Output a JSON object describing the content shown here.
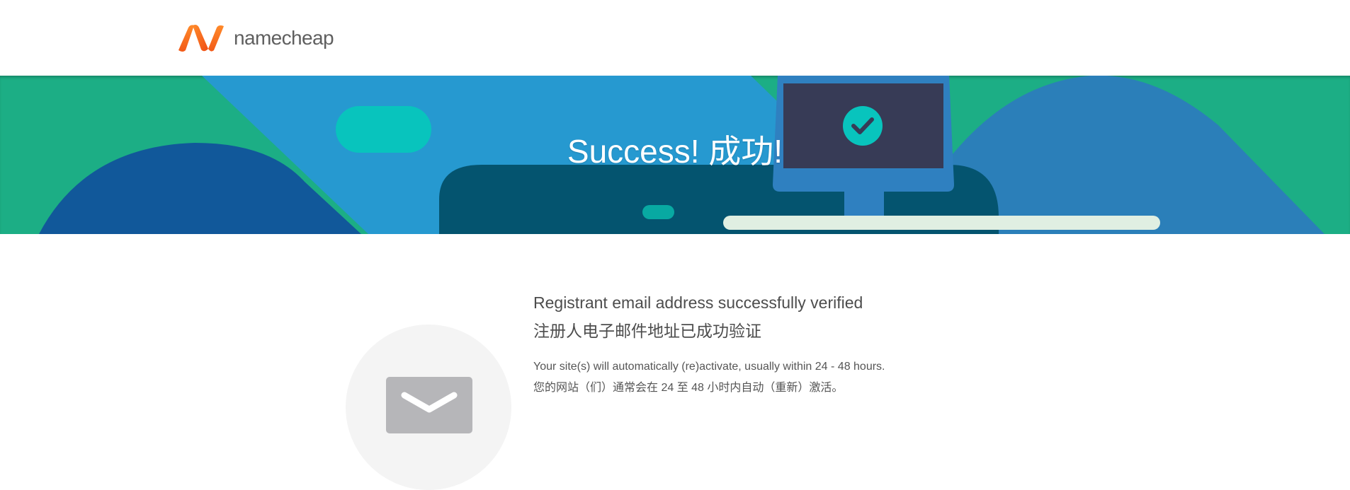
{
  "header": {
    "logo_text": "namecheap",
    "logo_icon": "namecheap-n-logo",
    "brand_colors": {
      "orange": "#ff6f1e",
      "orange_dark": "#e8501a"
    }
  },
  "banner": {
    "title": "Success! 成功!",
    "colors": {
      "green": "#1cae85",
      "blue": "#2699d0",
      "dark_blue": "#11589a",
      "steel_blue": "#2b7fb9",
      "navy_teal": "#04546f",
      "monitor_frame": "#2f80c0",
      "monitor_screen": "#373b56",
      "teal": "#08c4bd",
      "light_bar": "#e0efe2"
    },
    "icons": [
      "check-circle-icon",
      "monitor-illustration"
    ]
  },
  "message": {
    "title_en": "Registrant email address successfully verified",
    "title_zh": "注册人电子邮件地址已成功验证",
    "body_en": "Your site(s) will automatically (re)activate, usually within 24 - 48 hours.",
    "body_zh": "您的网站（们）通常会在 24 至 48 小时内自动（重新）激活。",
    "icon": "envelope-icon"
  }
}
